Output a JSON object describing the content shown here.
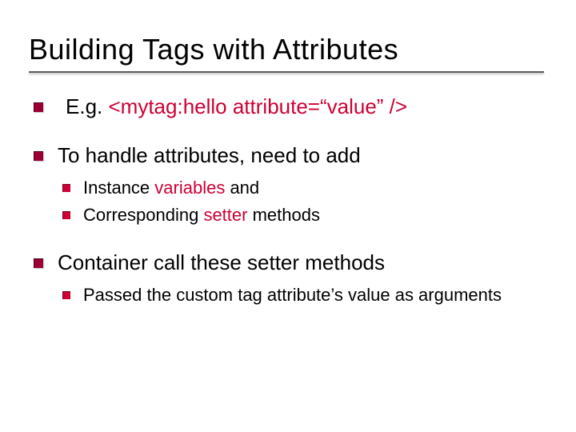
{
  "title": "Building Tags with Attributes",
  "bullets": [
    {
      "text_pre": " E.g. ",
      "accent": "<mytag:hello attribute=“value” />",
      "text_post": ""
    },
    {
      "text_pre": "To handle attributes, need to add",
      "children": [
        {
          "pre": "Instance ",
          "accent": "variables",
          "post": " and"
        },
        {
          "pre": "Corresponding ",
          "accent": "setter",
          "post": " methods"
        }
      ]
    },
    {
      "text_pre": "Container call these setter methods",
      "children": [
        {
          "pre": "Passed the custom tag attribute’s value as arguments",
          "accent": "",
          "post": ""
        }
      ]
    }
  ]
}
